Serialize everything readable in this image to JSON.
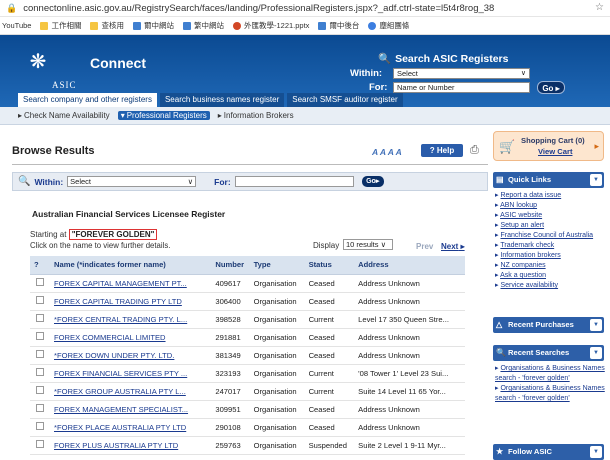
{
  "browser": {
    "url": "connectonline.asic.gov.au/RegistrySearch/faces/landing/ProfessionalRegisters.jspx?_adf.ctrl-state=l5t4r8rog_38",
    "bookmarks": [
      "YouTube",
      "工作相關",
      "查核用",
      "爾中網站",
      "繁中網站",
      "外匯教學-1221.pptx",
      "爾中後台",
      "塵組團條"
    ]
  },
  "header": {
    "brand": "Connect",
    "agency": "ASIC",
    "search_title": "Search ASIC Registers",
    "within_label": "Within:",
    "within_value": "Select",
    "for_label": "For:",
    "for_placeholder": "Name or Number",
    "go_label": "Go"
  },
  "tabs": [
    "Search company and other registers",
    "Search business names register",
    "Search SMSF auditor register"
  ],
  "subnav": [
    "Check Name Availability",
    "Professional Registers",
    "Information Brokers"
  ],
  "main": {
    "title": "Browse Results",
    "font_size_label": "A A A A",
    "help_label": "Help",
    "within_label": "Within:",
    "within_value": "Select",
    "for_label": "For:",
    "go_label": "Go",
    "register_title": "Australian Financial Services Licensee Register",
    "starting_prefix": "Starting at",
    "starting_value": "\"FOREVER GOLDEN\"",
    "click_hint": "Click on the name to view further details.",
    "display_label": "Display",
    "display_value": "10 results",
    "prev_label": "Prev",
    "next_label": "Next"
  },
  "table": {
    "columns": [
      "?",
      "Name (*indicates former name)",
      "Number",
      "Type",
      "Status",
      "Address"
    ],
    "rows": [
      [
        "FOREX CAPITAL MANAGEMENT PT...",
        "409617",
        "Organisation",
        "Ceased",
        "Address Unknown"
      ],
      [
        "FOREX CAPITAL TRADING PTY LTD",
        "306400",
        "Organisation",
        "Ceased",
        "Address Unknown"
      ],
      [
        "*FOREX CENTRAL TRADING PTY. L...",
        "398528",
        "Organisation",
        "Current",
        "Level 17 350 Queen Stre..."
      ],
      [
        "FOREX COMMERCIAL LIMITED",
        "291881",
        "Organisation",
        "Ceased",
        "Address Unknown"
      ],
      [
        "*FOREX DOWN UNDER PTY. LTD.",
        "381349",
        "Organisation",
        "Ceased",
        "Address Unknown"
      ],
      [
        "FOREX FINANCIAL SERVICES PTY ...",
        "323193",
        "Organisation",
        "Current",
        "'08 Tower 1' Level 23 Sui..."
      ],
      [
        "*FOREX GROUP AUSTRALIA PTY L...",
        "247017",
        "Organisation",
        "Current",
        "Suite 14 Level 11 65 Yor..."
      ],
      [
        "FOREX MANAGEMENT SPECIALIST...",
        "309951",
        "Organisation",
        "Ceased",
        "Address Unknown"
      ],
      [
        "*FOREX PLACE AUSTRALIA PTY LTD",
        "290108",
        "Organisation",
        "Ceased",
        "Address Unknown"
      ],
      [
        "FOREX PLUS AUSTRALIA PTY LTD",
        "259763",
        "Organisation",
        "Suspended",
        "Suite 2 Level 1 9-11 Myr..."
      ]
    ]
  },
  "sidebar": {
    "cart_title": "Shopping Cart (0)",
    "cart_link": "View Cart",
    "quick_links_title": "Quick Links",
    "quick_links": [
      "Report a data issue",
      "ABN lookup",
      "ASIC website",
      "Setup an alert",
      "Franchise Council of Australia",
      "Trademark check",
      "Information brokers",
      "NZ companies",
      "Ask a question",
      "Service availability"
    ],
    "recent_purchases_title": "Recent Purchases",
    "recent_searches_title": "Recent Searches",
    "recent_searches": [
      "Organisations & Business Names search - 'forever golden'",
      "Organisations & Business Names search - 'forever golden'"
    ],
    "follow_title": "Follow ASIC"
  }
}
